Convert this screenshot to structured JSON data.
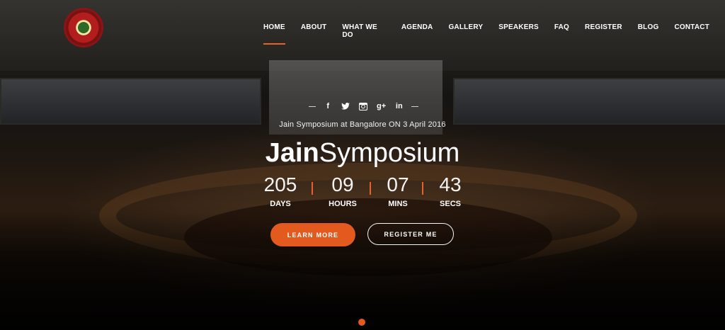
{
  "nav": {
    "items": [
      {
        "label": "HOME",
        "active": true
      },
      {
        "label": "ABOUT"
      },
      {
        "label": "WHAT WE DO"
      },
      {
        "label": "AGENDA"
      },
      {
        "label": "GALLERY"
      },
      {
        "label": "SPEAKERS"
      },
      {
        "label": "FAQ"
      },
      {
        "label": "REGISTER"
      },
      {
        "label": "BLOG"
      },
      {
        "label": "CONTACT"
      }
    ]
  },
  "social": {
    "icons": [
      "facebook-icon",
      "twitter-icon",
      "instagram-icon",
      "google-plus-icon",
      "linkedin-icon"
    ],
    "glyphs": [
      "f",
      "🐦",
      "◙",
      "g+",
      "in"
    ]
  },
  "hero": {
    "tagline": "Jain Symposium at Bangalore ON 3 April 2016",
    "title_bold": "Jain",
    "title_light": "Symposium",
    "countdown": [
      {
        "value": "205",
        "label": "DAYS"
      },
      {
        "value": "09",
        "label": "HOURS"
      },
      {
        "value": "07",
        "label": "MINS"
      },
      {
        "value": "43",
        "label": "SECS"
      }
    ],
    "learn_more": "LEARN MORE",
    "register_me": "REGISTER ME"
  },
  "colors": {
    "accent": "#e35a1f"
  }
}
